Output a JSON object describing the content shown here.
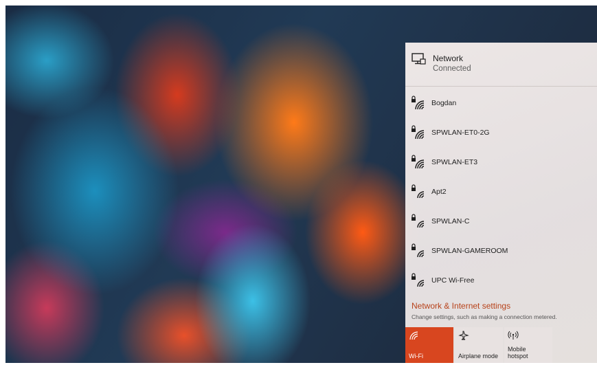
{
  "network_flyout": {
    "current_network": {
      "icon": "wired-monitor-icon",
      "name": "Network",
      "status": "Connected"
    },
    "wifi_networks": [
      {
        "name": "Bogdan",
        "icon": "secured-wifi-icon"
      },
      {
        "name": "SPWLAN-ET0-2G",
        "icon": "secured-wifi-icon"
      },
      {
        "name": "SPWLAN-ET3",
        "icon": "secured-wifi-icon"
      },
      {
        "name": "Apt2",
        "icon": "secured-wifi-icon"
      },
      {
        "name": "SPWLAN-C",
        "icon": "secured-wifi-icon"
      },
      {
        "name": "SPWLAN-GAMEROOM",
        "icon": "secured-wifi-icon"
      },
      {
        "name": "UPC Wi-Free",
        "icon": "secured-wifi-icon"
      }
    ],
    "settings_link": "Network & Internet settings",
    "settings_description": "Change settings, such as making a connection metered.",
    "quick_actions": {
      "wifi": {
        "label": "Wi-Fi",
        "icon": "wifi-icon",
        "active": true
      },
      "airplane": {
        "label": "Airplane mode",
        "icon": "airplane-icon",
        "active": false
      },
      "hotspot": {
        "label": "Mobile hotspot",
        "label_line1": "Mobile",
        "label_line2": "hotspot",
        "icon": "hotspot-icon",
        "active": false
      }
    }
  },
  "colors": {
    "accent": "#d8461f",
    "link": "#b7421a",
    "panel_bg": "#f1ebe9"
  }
}
